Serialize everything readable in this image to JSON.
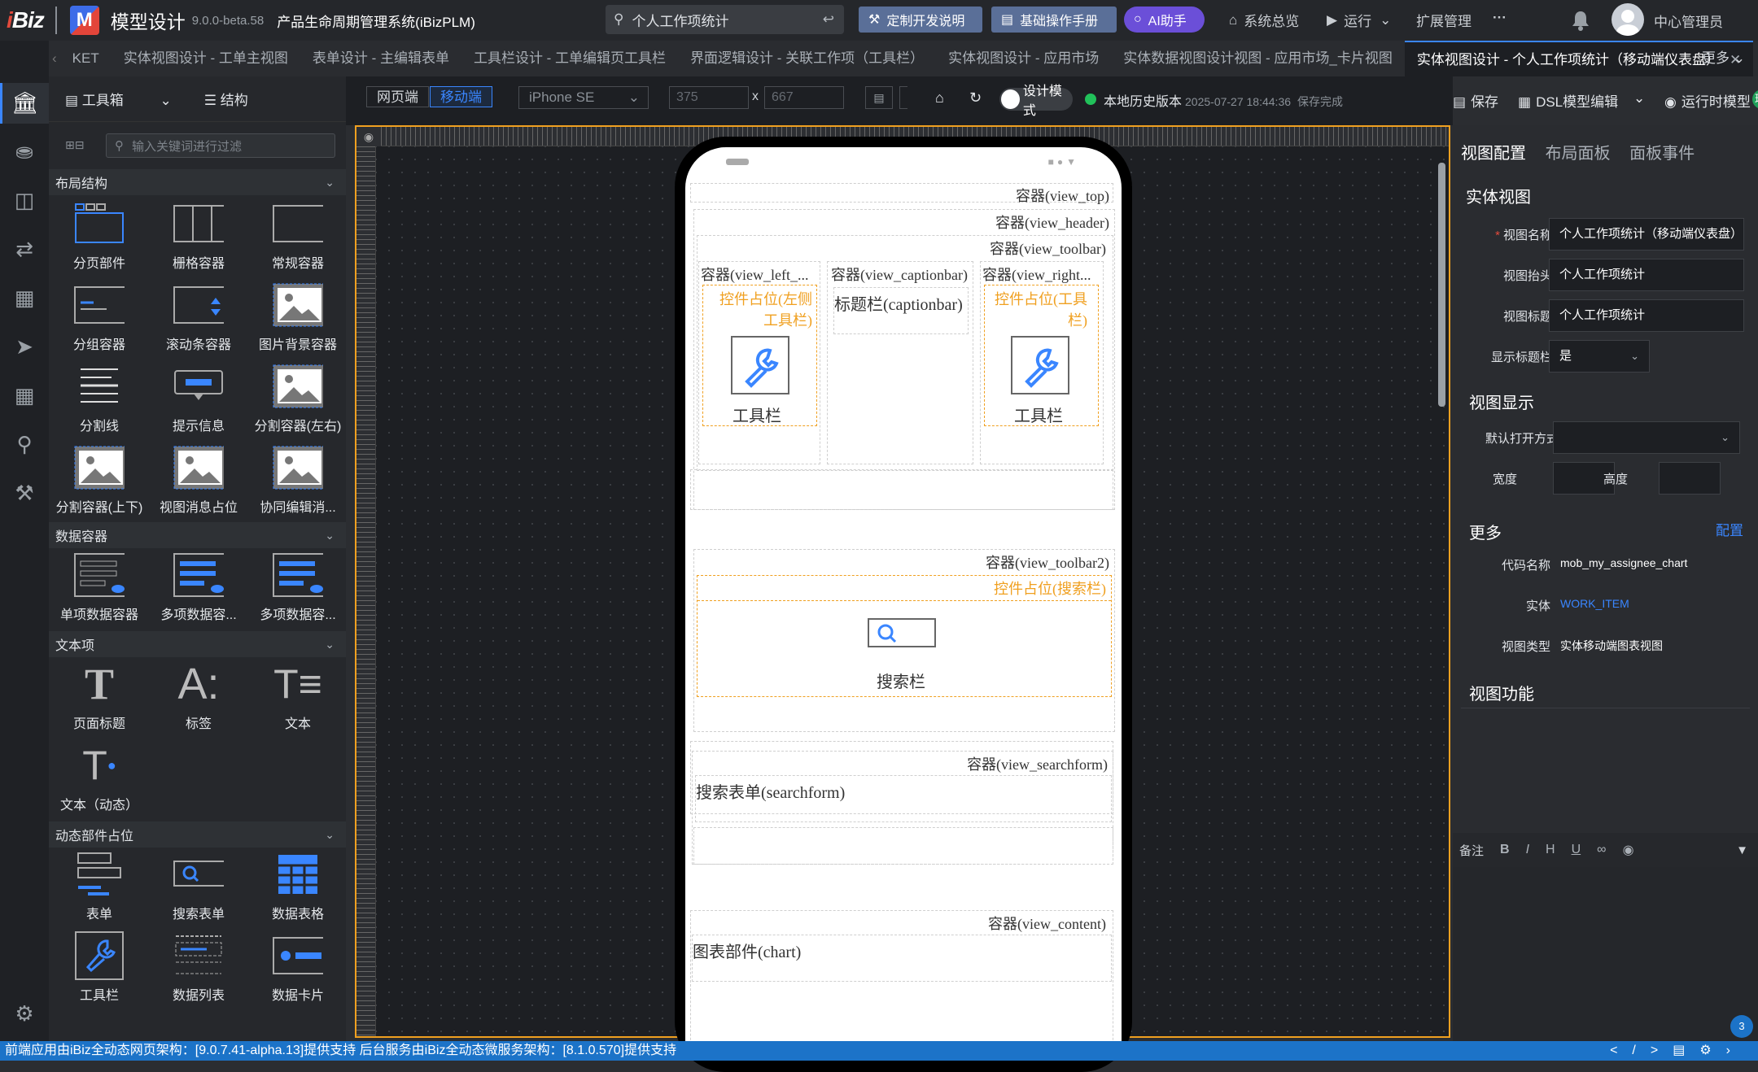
{
  "app": {
    "brand": "iBiz",
    "title": "模型设计",
    "version": "9.0.0-beta.58",
    "system": "产品生命周期管理系统(iBizPLM)"
  },
  "top_search": {
    "value": "个人工作项统计"
  },
  "top_buttons": {
    "custom_dev": "定制开发说明",
    "manual": "基础操作手册",
    "ai": "AI助手"
  },
  "top_nav": {
    "overview": "系统总览",
    "run": "运行",
    "ext": "扩展管理",
    "more": "···",
    "user": "中心管理员"
  },
  "tabs": [
    {
      "label": "KET"
    },
    {
      "label": "实体视图设计 - 工单主视图"
    },
    {
      "label": "表单设计 - 主编辑表单"
    },
    {
      "label": "工具栏设计 - 工单编辑页工具栏"
    },
    {
      "label": "界面逻辑设计 - 关联工作项（工具栏）"
    },
    {
      "label": "实体视图设计 - 应用市场"
    },
    {
      "label": "实体数据视图设计视图 - 应用市场_卡片视图"
    },
    {
      "label": "实体视图设计 - 个人工作项统计（移动端仪表盘）"
    }
  ],
  "tabs_more": "更多",
  "toolbox": {
    "title": "工具箱",
    "structure": "结构",
    "filter_placeholder": "输入关键词进行过滤",
    "groups": [
      {
        "title": "布局结构",
        "items": [
          "分页部件",
          "栅格容器",
          "常规容器",
          "分组容器",
          "滚动条容器",
          "图片背景容器",
          "分割线",
          "提示信息",
          "分割容器(左右)",
          "分割容器(上下)",
          "视图消息占位",
          "协同编辑消..."
        ]
      },
      {
        "title": "数据容器",
        "items": [
          "单项数据容器",
          "多项数据容...",
          "多项数据容..."
        ]
      },
      {
        "title": "文本项",
        "items": [
          "页面标题",
          "标签",
          "文本",
          "文本（动态）"
        ]
      },
      {
        "title": "动态部件占位",
        "items": [
          "表单",
          "搜索表单",
          "数据表格",
          "工具栏",
          "数据列表",
          "数据卡片"
        ]
      }
    ]
  },
  "designer": {
    "web": "网页端",
    "mobile": "移动端",
    "device": "iPhone SE",
    "width": "375",
    "height": "667",
    "x": "x",
    "design_mode": "设计模式",
    "history": "本地历史版本",
    "history_time": "2025-07-27 18:44:36",
    "saved": "保存完成",
    "admin_badge": "理员",
    "save": "保存",
    "dsl": "DSL模型编辑",
    "runtime": "运行时模型"
  },
  "phone": {
    "view_top": "容器(view_top)",
    "view_header": "容器(view_header)",
    "view_toolbar": "容器(view_toolbar)",
    "view_left": "容器(view_left_...",
    "view_captionbar": "容器(view_captionbar)",
    "view_right": "容器(view_right...",
    "left_placeholder": "控件占位(左侧工具栏)",
    "right_placeholder": "控件占位(工具栏)",
    "toolbar": "工具栏",
    "caption": "标题栏(captionbar)",
    "view_toolbar2": "容器(view_toolbar2)",
    "search_placeholder": "控件占位(搜索栏)",
    "searchbar": "搜索栏",
    "view_searchform": "容器(view_searchform)",
    "searchform": "搜索表单(searchform)",
    "view_content": "容器(view_content)",
    "chart": "图表部件(chart)"
  },
  "props": {
    "tabs": [
      "视图配置",
      "布局面板",
      "面板事件"
    ],
    "entity_view": "实体视图",
    "view_name_label": "视图名称",
    "view_name": "个人工作项统计（移动端仪表盘）",
    "view_header_label": "视图抬头",
    "view_header": "个人工作项统计",
    "view_title_label": "视图标题",
    "view_title": "个人工作项统计",
    "show_title_label": "显示标题栏",
    "show_title": "是",
    "view_display": "视图显示",
    "open_mode_label": "默认打开方式",
    "width_label": "宽度",
    "height_label": "高度",
    "more": "更多",
    "config": "配置",
    "code_label": "代码名称",
    "code": "mob_my_assignee_chart",
    "entity_label": "实体",
    "entity": "WORK_ITEM",
    "type_label": "视图类型",
    "type": "实体移动端图表视图",
    "functions": "视图功能",
    "note": "备注"
  },
  "statusbar": {
    "text": "前端应用由iBiz全动态网页架构：[9.0.7.41-alpha.13]提供支持 后台服务由iBiz全动态微服务架构：[8.1.0.570]提供支持",
    "badge": "3"
  }
}
